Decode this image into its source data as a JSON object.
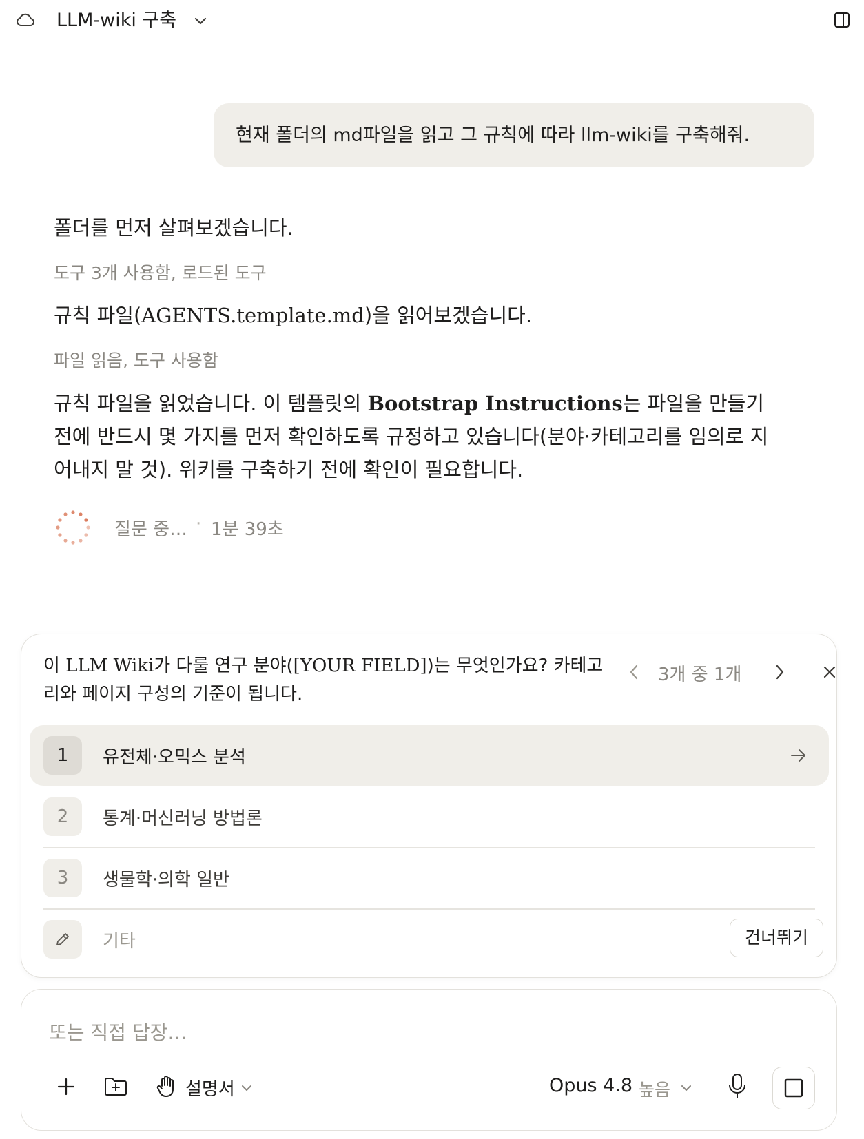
{
  "header": {
    "title": "LLM-wiki 구축",
    "icons": [
      "cloud-icon",
      "chevron-down-icon",
      "panel-toggle-icon"
    ]
  },
  "conversation": {
    "user_message": "현재 폴더의 md파일을 읽고 그 규칙에 따라 llm-wiki를 구축해줘.",
    "assistant": {
      "line_1": "폴더를 먼저 살펴보겠습니다.",
      "tool_summary_1": "도구 3개 사용함, 로드된 도구",
      "line_2_prefix": "규칙 파일(",
      "line_2_file": "AGENTS.template.md",
      "line_2_suffix": ")을 읽어보겠습니다.",
      "tool_summary_2": "파일 읽음, 도구 사용함",
      "para_prefix": "규칙 파일을 읽었습니다. 이 템플릿의 ",
      "para_bold": "Bootstrap Instructions",
      "para_suffix": "는 파일을 만들기 전에 반드시 몇 가지를 먼저 확인하도록 규정하고 있습니다(분야·카테고리를 임의로 지어내지 말 것). 위키를 구축하기 전에 확인이 필요합니다.",
      "status_label": "질문 중…",
      "status_separator": "·",
      "status_elapsed": "1분 39초"
    }
  },
  "question_card": {
    "question_prefix": "이 ",
    "question_serif_1": "LLM Wiki",
    "question_mid": "가 다룰 연구 분야(",
    "question_serif_2": "[YOUR FIELD]",
    "question_suffix": ")는 무엇인가요? 카테고리와 페이지 구성의 기준이 됩니다.",
    "counter": "3개 중 1개",
    "options": [
      {
        "number": "1",
        "label": "유전체·오믹스 분석",
        "selected": true
      },
      {
        "number": "2",
        "label": "통계·머신러닝 방법론",
        "selected": false
      },
      {
        "number": "3",
        "label": "생물학·의학 일반",
        "selected": false
      }
    ],
    "other_label": "기타",
    "skip_label": "건너뛰기"
  },
  "composer": {
    "placeholder": "또는 직접 답장…",
    "style_label": "설명서",
    "model_label": "Opus 4.8",
    "effort_label": "높음"
  },
  "colors": {
    "accent_spinner": "#d97757",
    "bubble_bg": "#f0eee9",
    "text_primary": "#1f1e1d",
    "text_muted": "#8a8781"
  }
}
